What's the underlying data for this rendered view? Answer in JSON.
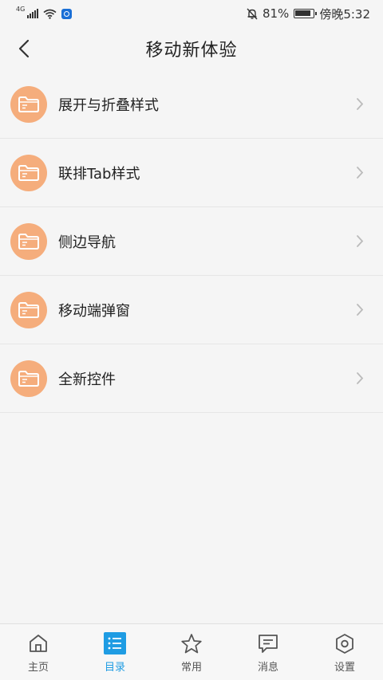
{
  "status_bar": {
    "network": "4G",
    "battery": "81%",
    "time": "傍晚5:32"
  },
  "header": {
    "title": "移动新体验"
  },
  "list": {
    "items": [
      {
        "label": "展开与折叠样式",
        "icon": "folder-icon"
      },
      {
        "label": "联排Tab样式",
        "icon": "folder-icon"
      },
      {
        "label": "侧边导航",
        "icon": "folder-icon"
      },
      {
        "label": "移动端弹窗",
        "icon": "folder-icon"
      },
      {
        "label": "全新控件",
        "icon": "folder-icon"
      }
    ]
  },
  "tab_bar": {
    "tabs": [
      {
        "label": "主页",
        "icon": "home-icon"
      },
      {
        "label": "目录",
        "icon": "catalog-list-icon",
        "active": true
      },
      {
        "label": "常用",
        "icon": "star-icon"
      },
      {
        "label": "消息",
        "icon": "message-icon"
      },
      {
        "label": "设置",
        "icon": "settings-icon"
      }
    ]
  },
  "colors": {
    "accent": "#1f9ce3",
    "folder_bg": "#f5ad7c"
  }
}
